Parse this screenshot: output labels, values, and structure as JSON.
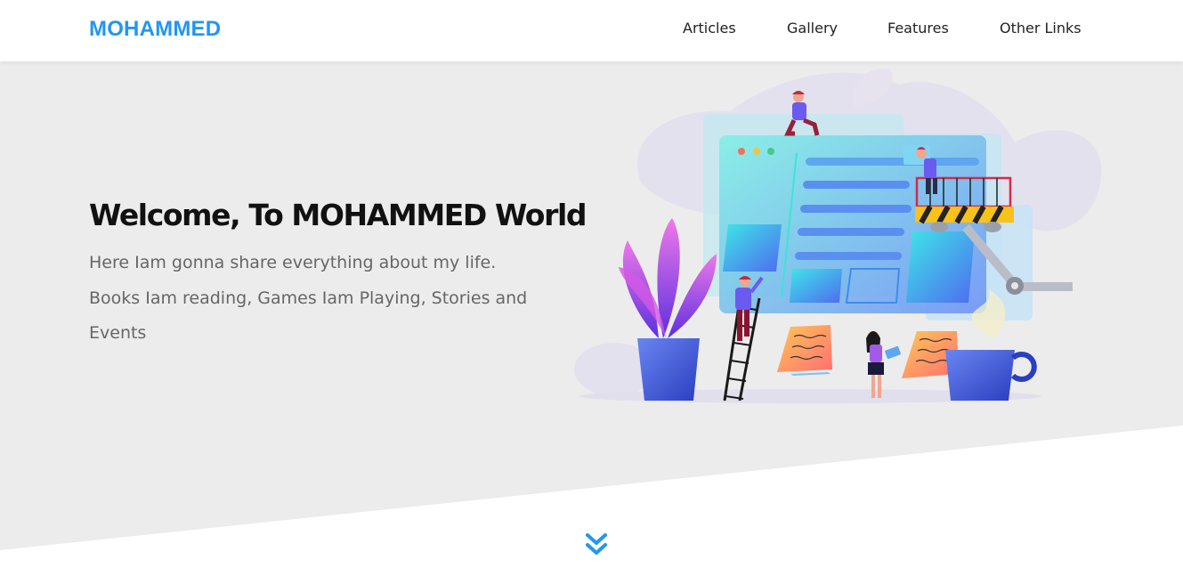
{
  "brand": {
    "logo_text": "MOHAMMED",
    "accent_color": "#2196f3"
  },
  "nav": {
    "items": [
      {
        "label": "Articles"
      },
      {
        "label": "Gallery"
      },
      {
        "label": "Features"
      },
      {
        "label": "Other Links"
      }
    ]
  },
  "hero": {
    "title": "Welcome, To MOHAMMED World",
    "description": "Here Iam gonna share everything about my life. Books Iam reading, Games Iam Playing, Stories and Events",
    "background_color": "#ececec",
    "illustration_icon": "web-development-illustration-icon"
  },
  "scroll": {
    "icon": "double-chevron-down-icon"
  }
}
